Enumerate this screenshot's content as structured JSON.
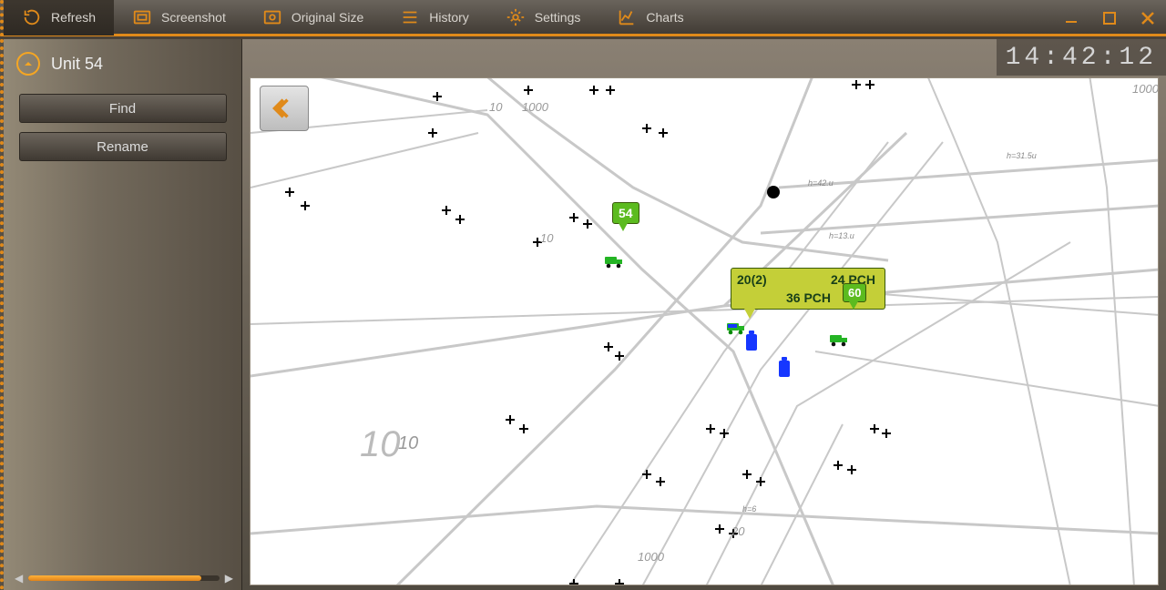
{
  "toolbar": {
    "refresh": "Refresh",
    "screenshot": "Screenshot",
    "original_size": "Original Size",
    "history": "History",
    "settings": "Settings",
    "charts": "Charts"
  },
  "sidebar": {
    "unit_title": "Unit 54",
    "find": "Find",
    "rename": "Rename"
  },
  "clock": "14:42:12",
  "map": {
    "big_label": "10",
    "labels": {
      "l1": "1000",
      "l2": "10",
      "l3": "1000",
      "l4": "1000",
      "l5": "10",
      "l6": "10",
      "l7": "20"
    },
    "markers": {
      "unit54": "54",
      "combo": "20(2)",
      "pch1": "24 PCH",
      "pch2": "36 PCH",
      "sixty": "60"
    },
    "annot": {
      "h315": "h=31.5u",
      "h42": "h=42.u",
      "h13": "h=13.u",
      "h6": "h=6"
    }
  }
}
